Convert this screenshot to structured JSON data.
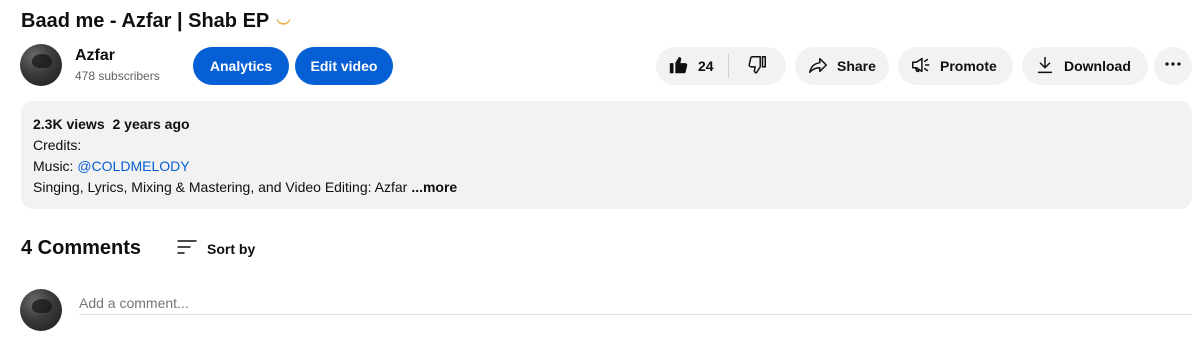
{
  "video": {
    "title": "Baad me - Azfar | Shab EP",
    "title_emoji": "🌙"
  },
  "channel": {
    "name": "Azfar",
    "subscribers": "478 subscribers"
  },
  "actions": {
    "analytics_label": "Analytics",
    "edit_label": "Edit video",
    "like_count": "24",
    "share_label": "Share",
    "promote_label": "Promote",
    "download_label": "Download",
    "accent_color": "#065fd4"
  },
  "description": {
    "views": "2.3K views",
    "age": "2 years ago",
    "line1": "Credits:",
    "music_prefix": "Music: ",
    "music_link": "@COLDMELODY",
    "line3": "Singing, Lyrics, Mixing & Mastering, and Video Editing: Azfar",
    "more_label": "...more"
  },
  "comments": {
    "count_label": "4 Comments",
    "sort_label": "Sort by",
    "add_placeholder": "Add a comment..."
  },
  "icons": [
    "thumbs-up-icon",
    "thumbs-down-icon",
    "share-icon",
    "promote-icon",
    "download-icon",
    "more-vert-icon",
    "sort-icon"
  ]
}
